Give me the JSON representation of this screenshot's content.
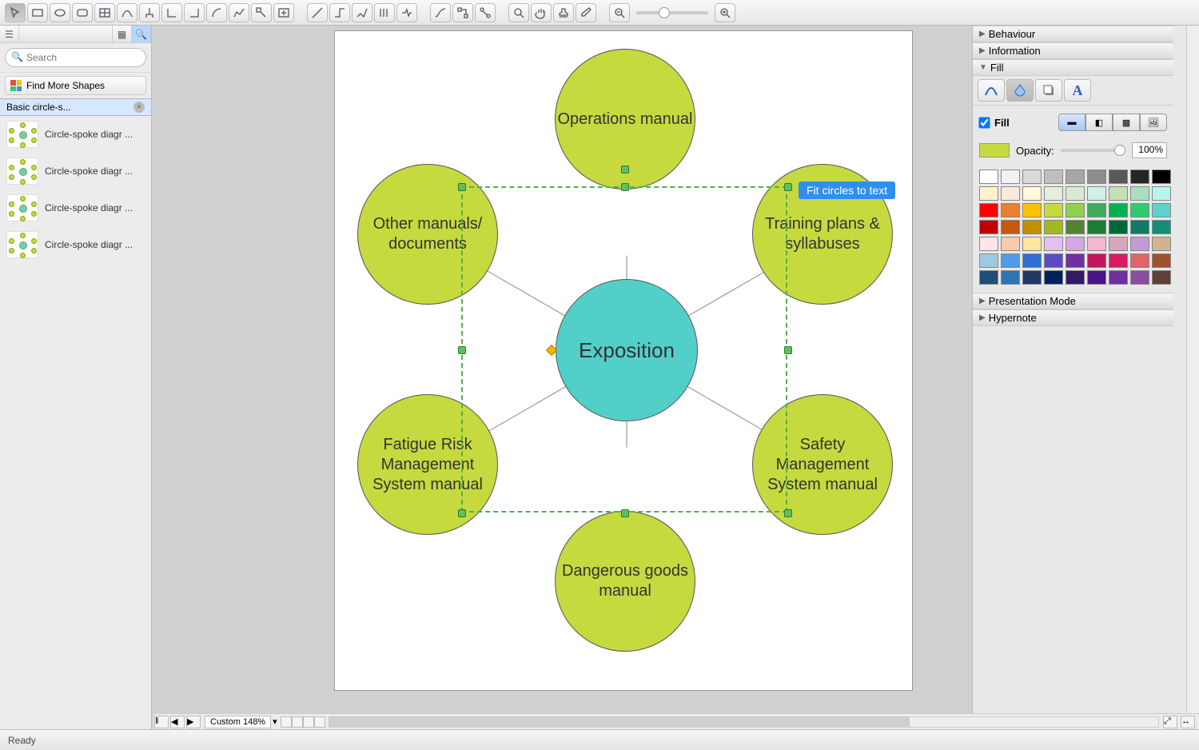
{
  "toolbar_icons": [
    "cursor",
    "rect",
    "ellipse",
    "rounded",
    "table",
    "bezier",
    "tree",
    "connect-l",
    "connect-r",
    "arc",
    "poly",
    "anchor",
    "insert",
    "line",
    "ortho",
    "step",
    "parallel",
    "route",
    "smart-c1",
    "smart-c2",
    "smart-c3",
    "zoom-tool",
    "pan-hand",
    "stamp",
    "eyedropper",
    "zoom-out",
    "zoom-in"
  ],
  "sidebar": {
    "search_placeholder": "Search",
    "find_more": "Find More Shapes",
    "lib_name": "Basic circle-s...",
    "shapes": [
      "Circle-spoke diagr ...",
      "Circle-spoke diagr ...",
      "Circle-spoke diagr ...",
      "Circle-spoke diagr ..."
    ]
  },
  "diagram": {
    "center": "Exposition",
    "nodes": [
      "Operations manual",
      "Training plans & syllabuses",
      "Safety Management System manual",
      "Dangerous goods manual",
      "Fatigue Risk Management System manual",
      "Other manuals/ documents"
    ],
    "tooltip": "Fit circles to text"
  },
  "rpanel": {
    "sections": {
      "behaviour": "Behaviour",
      "information": "Information",
      "fill": "Fill",
      "presentation": "Presentation Mode",
      "hypernote": "Hypernote"
    },
    "fill_label": "Fill",
    "opacity_label": "Opacity:",
    "opacity_value": "100%"
  },
  "palette": [
    "#ffffff",
    "#f2f2f2",
    "#d9d9d9",
    "#bfbfbf",
    "#a6a6a6",
    "#8c8c8c",
    "#595959",
    "#262626",
    "#000000",
    "#fff2cc",
    "#fde9d9",
    "#fff9d9",
    "#e2efda",
    "#d9ead3",
    "#d0f0e8",
    "#c5e0b4",
    "#a9dfbf",
    "#b7f5ee",
    "#ff0000",
    "#ed7d31",
    "#ffc000",
    "#c6d93f",
    "#92d050",
    "#41ab5d",
    "#00b050",
    "#2ecc71",
    "#5fd0cd",
    "#c00000",
    "#c65911",
    "#bf8f00",
    "#a2b822",
    "#548235",
    "#1e7b34",
    "#006837",
    "#117a65",
    "#148f77",
    "#fce4ec",
    "#f8cbad",
    "#ffe699",
    "#e2c0f0",
    "#d4a6e8",
    "#f4b6d2",
    "#d5a6bd",
    "#c39bd3",
    "#d2b48c",
    "#9ecae1",
    "#4f9be8",
    "#2f6fd0",
    "#5b4bc4",
    "#7030a0",
    "#c2185b",
    "#d81b60",
    "#e06666",
    "#a0522d",
    "#1f4e79",
    "#2e75b6",
    "#1f3864",
    "#002060",
    "#321a64",
    "#4a148c",
    "#702fa0",
    "#884ea0",
    "#5d4037"
  ],
  "bottom": {
    "zoom": "Custom 148%"
  },
  "status": "Ready"
}
